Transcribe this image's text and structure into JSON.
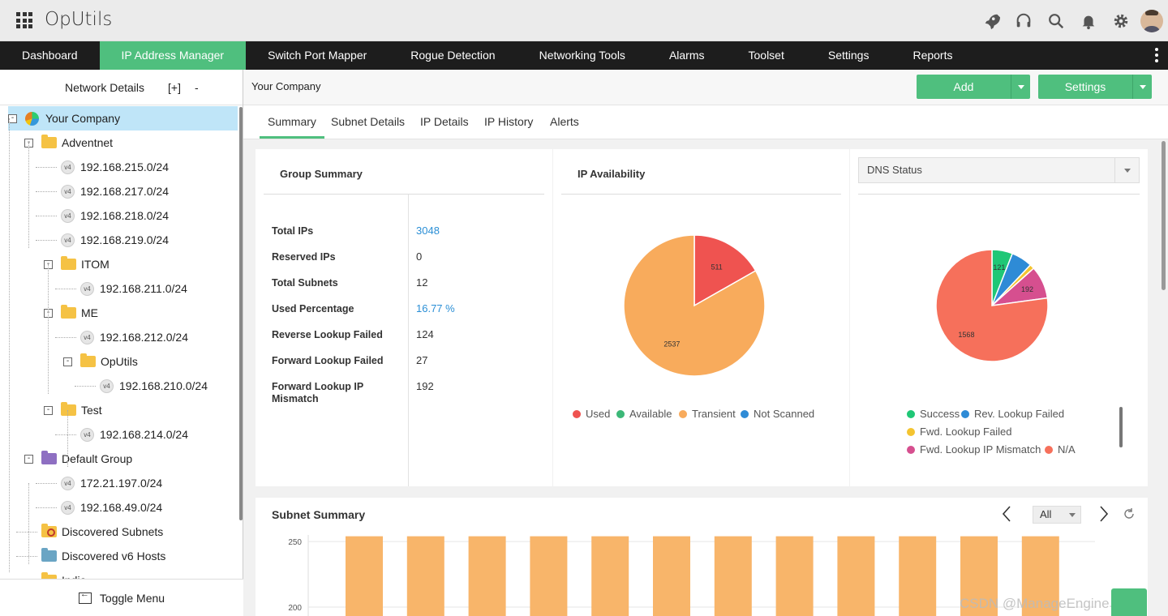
{
  "app": {
    "title": "OpUtils"
  },
  "nav": [
    "Dashboard",
    "IP Address Manager",
    "Switch Port Mapper",
    "Rogue Detection",
    "Networking Tools",
    "Alarms",
    "Toolset",
    "Settings",
    "Reports"
  ],
  "nav_active_index": 1,
  "sidebar": {
    "title": "Network Details",
    "expand": "[+]",
    "collapse": "-",
    "toggle_menu": "Toggle Menu",
    "tree": [
      {
        "label": "Your Company",
        "kind": "root",
        "toggle": "-",
        "selected": true
      },
      {
        "label": "Adventnet",
        "kind": "folder",
        "toggle": "-"
      },
      {
        "label": "192.168.215.0/24",
        "kind": "subnet",
        "badge": "v4"
      },
      {
        "label": "192.168.217.0/24",
        "kind": "subnet",
        "badge": "v4"
      },
      {
        "label": "192.168.218.0/24",
        "kind": "subnet",
        "badge": "v4"
      },
      {
        "label": "192.168.219.0/24",
        "kind": "subnet",
        "badge": "v4"
      },
      {
        "label": "ITOM",
        "kind": "folder",
        "toggle": "-"
      },
      {
        "label": "192.168.211.0/24",
        "kind": "subnet",
        "badge": "v4"
      },
      {
        "label": "ME",
        "kind": "folder",
        "toggle": "-"
      },
      {
        "label": "192.168.212.0/24",
        "kind": "subnet",
        "badge": "v4"
      },
      {
        "label": "OpUtils",
        "kind": "folder",
        "toggle": "-"
      },
      {
        "label": "192.168.210.0/24",
        "kind": "subnet",
        "badge": "v4"
      },
      {
        "label": "Test",
        "kind": "folder",
        "toggle": "-"
      },
      {
        "label": "192.168.214.0/24",
        "kind": "subnet",
        "badge": "v4"
      },
      {
        "label": "Default Group",
        "kind": "folder-purple",
        "toggle": "-"
      },
      {
        "label": "172.21.197.0/24",
        "kind": "subnet",
        "badge": "v4"
      },
      {
        "label": "192.168.49.0/24",
        "kind": "subnet",
        "badge": "v4"
      },
      {
        "label": "Discovered Subnets",
        "kind": "folder-search"
      },
      {
        "label": "Discovered v6 Hosts",
        "kind": "folder-v6"
      },
      {
        "label": "India",
        "kind": "folder"
      }
    ]
  },
  "content": {
    "breadcrumb": "Your Company",
    "add_label": "Add",
    "settings_label": "Settings",
    "tabs": [
      "Summary",
      "Subnet Details",
      "IP Details",
      "IP History",
      "Alerts"
    ],
    "active_tab_index": 0
  },
  "group_summary": {
    "title": "Group Summary",
    "rows": [
      {
        "label": "Total IPs",
        "value": "3048",
        "link": true
      },
      {
        "label": "Reserved IPs",
        "value": "0"
      },
      {
        "label": "Total Subnets",
        "value": "12"
      },
      {
        "label": "Used Percentage",
        "value": "16.77 %",
        "link": true
      },
      {
        "label": "Reverse Lookup Failed",
        "value": "124"
      },
      {
        "label": "Forward Lookup Failed",
        "value": "27"
      },
      {
        "label": "Forward Lookup IP Mismatch",
        "value": "192"
      }
    ]
  },
  "ip_availability": {
    "title": "IP Availability"
  },
  "dns_status": {
    "selected": "DNS Status"
  },
  "subnet_summary": {
    "title": "Subnet Summary",
    "filter": "All"
  },
  "watermark": "CSDN @ManageEngine卓豪",
  "colors": {
    "accent": "#4fbf7e",
    "nav_bg": "#1d1d1d",
    "link": "#2b8fd6",
    "bar": "#f8b56a"
  },
  "chart_data": [
    {
      "type": "pie",
      "title": "IP Availability",
      "series": [
        {
          "name": "Used",
          "value": 511,
          "color": "#ef5350",
          "label": "511"
        },
        {
          "name": "Available",
          "value": 0,
          "color": "#3cb878",
          "label": ""
        },
        {
          "name": "Transient",
          "value": 2537,
          "color": "#f8ab5c",
          "label": "2537"
        },
        {
          "name": "Not Scanned",
          "value": 0,
          "color": "#2e8bd6",
          "label": ""
        }
      ]
    },
    {
      "type": "pie",
      "title": "DNS Status",
      "series": [
        {
          "name": "Success",
          "value": 121,
          "color": "#1fc776",
          "label": "121"
        },
        {
          "name": "Rev. Lookup Failed",
          "value": 124,
          "color": "#2e8bd6",
          "label": ""
        },
        {
          "name": "Fwd. Lookup Failed",
          "value": 27,
          "color": "#f4c430",
          "label": ""
        },
        {
          "name": "Fwd. Lookup IP Mismatch",
          "value": 192,
          "color": "#d64f8f",
          "label": "192"
        },
        {
          "name": "N/A",
          "value": 1568,
          "color": "#f6705b",
          "label": "1568"
        }
      ]
    },
    {
      "type": "bar",
      "title": "Subnet Summary",
      "ylim": [
        150,
        255
      ],
      "yticks": [
        250,
        200
      ],
      "categories": [
        "",
        "",
        "",
        "",
        "",
        "",
        "",
        "",
        "",
        "",
        "",
        ""
      ],
      "values": [
        254,
        254,
        254,
        254,
        254,
        254,
        254,
        254,
        254,
        254,
        254,
        254
      ]
    }
  ]
}
